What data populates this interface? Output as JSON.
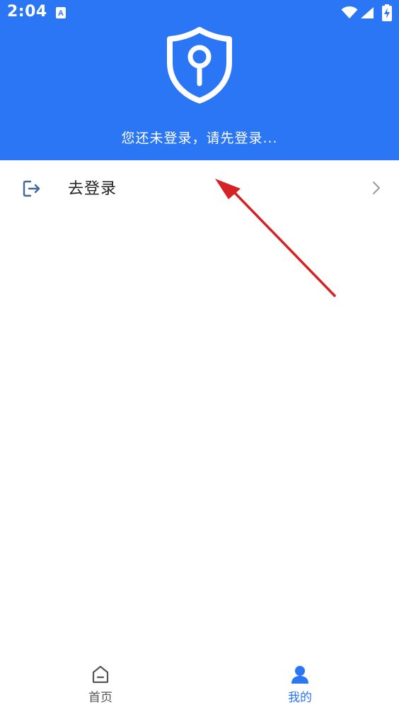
{
  "status_bar": {
    "time": "2:04",
    "app_icon": "font-a-icon",
    "wifi_icon": "wifi-icon",
    "signal_icon": "cell-signal-icon",
    "battery_icon": "battery-charging-icon"
  },
  "header": {
    "background_color": "#2A76F5",
    "icon": "shield-keyhole-icon",
    "prompt": "您还未登录，请先登录..."
  },
  "menu": {
    "items": [
      {
        "label": "去登录",
        "icon": "login-icon",
        "trailing_icon": "chevron-right-icon"
      }
    ]
  },
  "annotation": {
    "type": "arrow",
    "color": "#D62222"
  },
  "bottom_nav": {
    "items": [
      {
        "label": "首页",
        "icon": "home-icon",
        "active": false
      },
      {
        "label": "我的",
        "icon": "user-icon",
        "active": true
      }
    ],
    "active_color": "#2A76F5",
    "inactive_color": "#555555"
  }
}
